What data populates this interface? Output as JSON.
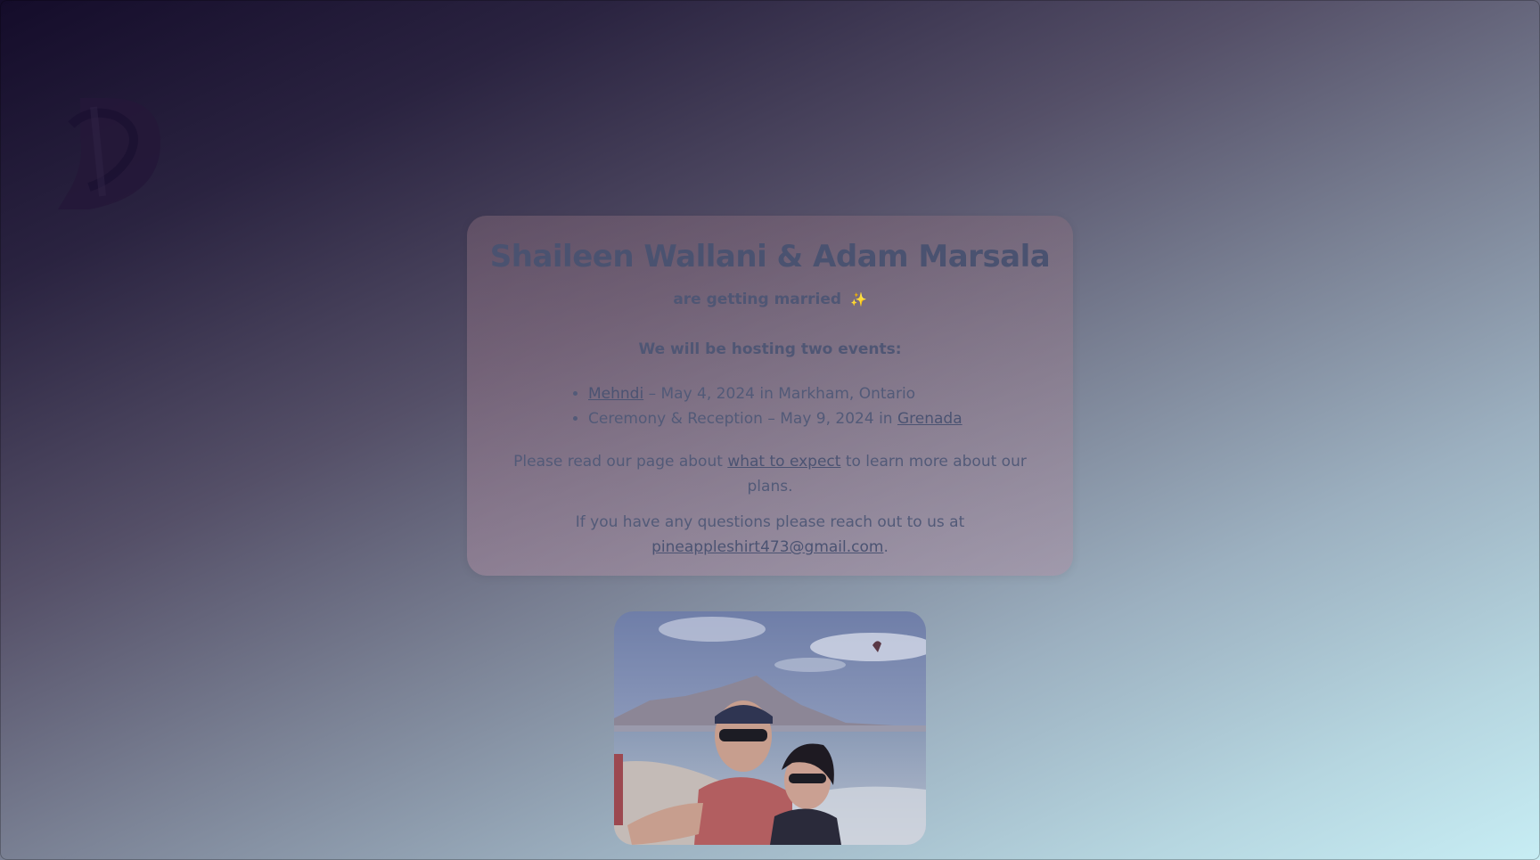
{
  "header": {
    "logo_icon": "monogram-logo-icon"
  },
  "card": {
    "title": "Shaileen Wallani & Adam Marsala",
    "subtitle": "are getting married",
    "subtitle_emoji": "✨",
    "events_heading": "We will be hosting two events:",
    "events": [
      {
        "link": "Mehndi",
        "text": " – May 4, 2024 in Markham, Ontario"
      },
      {
        "text": "Ceremony & Reception – May 9, 2024 in ",
        "link": "Grenada"
      }
    ],
    "expect_prefix": "Please read our page about ",
    "expect_link": "what to expect",
    "expect_suffix": " to learn more about our plans.",
    "contact_prefix": "If you have any questions please reach out to us at ",
    "contact_email": "pineappleshirt473@gmail.com",
    "contact_suffix": "."
  },
  "photo": {
    "alt": "Couple selfie on a beach"
  },
  "colors": {
    "text": "#4b5270",
    "card_bg": "#8c6e7d",
    "gradient_start": "#140c2a",
    "gradient_end": "#c7edf4"
  }
}
